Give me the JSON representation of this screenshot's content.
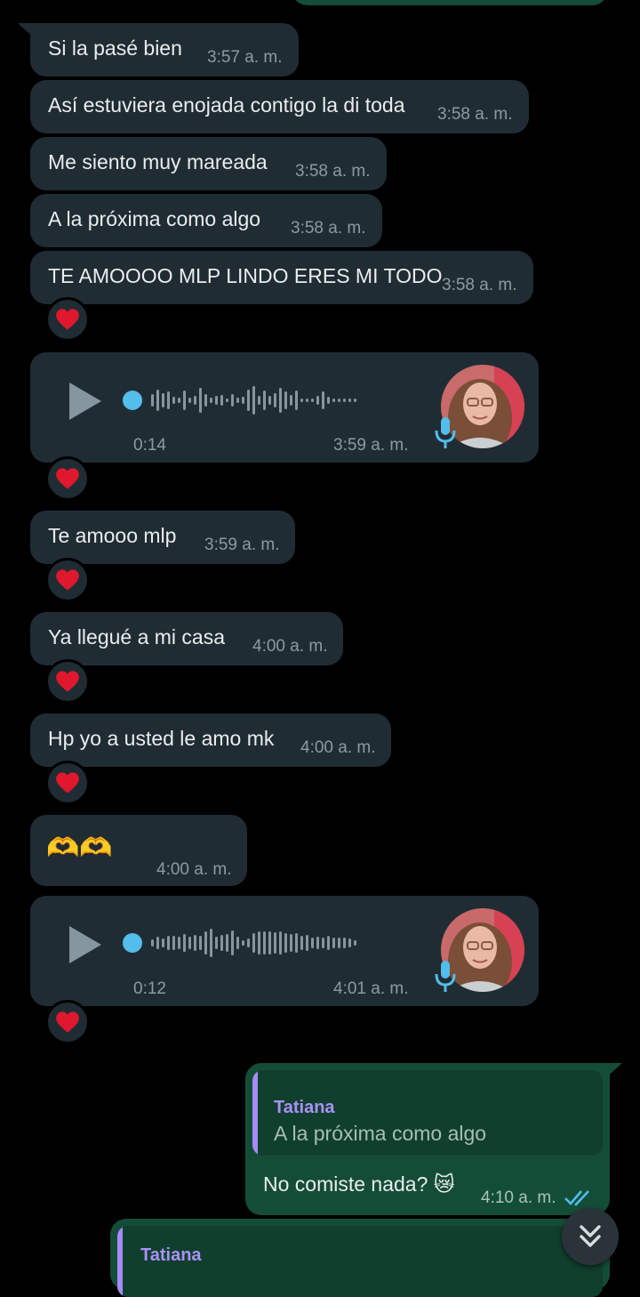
{
  "messages": {
    "m1": {
      "text": "Si la pasé bien",
      "time": "3:57 a. m."
    },
    "m2": {
      "text": "Así estuviera enojada contigo la di toda",
      "time": "3:58 a. m."
    },
    "m3": {
      "text": "Me siento muy mareada",
      "time": "3:58 a. m."
    },
    "m4": {
      "text": "A la próxima como algo",
      "time": "3:58 a. m."
    },
    "m5": {
      "text": "TE AMOOOO MLP LINDO ERES MI TODO",
      "time": "3:58 a. m."
    },
    "v1": {
      "duration": "0:14",
      "time": "3:59 a. m."
    },
    "m6": {
      "text": "Te amooo mlp",
      "time": "3:59 a. m."
    },
    "m7": {
      "text": "Ya llegué a mi casa",
      "time": "4:00 a. m."
    },
    "m8": {
      "text": "Hp yo a usted le amo mk",
      "time": "4:00 a. m."
    },
    "m9": {
      "text": "🫶🫶",
      "time": "4:00 a. m."
    },
    "v2": {
      "duration": "0:12",
      "time": "4:01 a. m."
    },
    "out1": {
      "quote_name": "Tatiana",
      "quote_text": "A la próxima como algo",
      "text": "No comiste nada? 😿",
      "time": "4:10 a. m."
    },
    "out2": {
      "quote_name": "Tatiana"
    }
  },
  "colors": {
    "incoming": "#202c33",
    "outgoing": "#144d37",
    "quote_accent": "#a78bfa",
    "read_ticks": "#53bdeb",
    "reaction_heart": "#e0182d"
  },
  "icons": {
    "reaction": "heart-icon",
    "voice": "mic-icon",
    "play": "play-icon",
    "scroll": "double-chevron-down-icon",
    "ticks": "double-check-icon"
  }
}
